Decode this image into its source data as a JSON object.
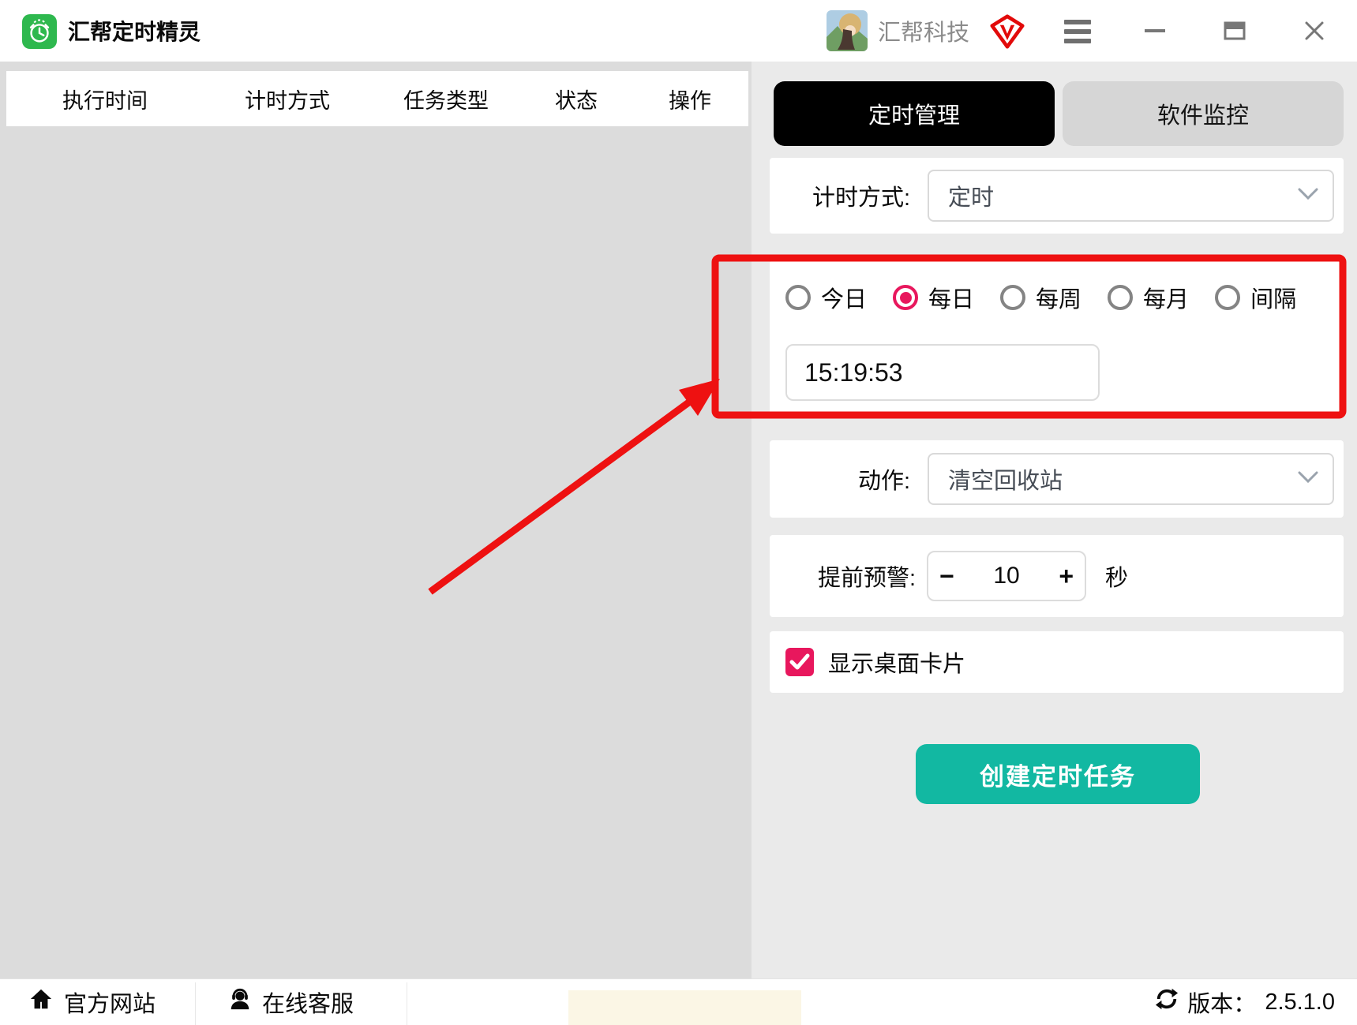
{
  "titlebar": {
    "app_title": "汇帮定时精灵",
    "brand": "汇帮科技"
  },
  "task_table": {
    "headers": [
      "执行时间",
      "计时方式",
      "任务类型",
      "状态",
      "操作"
    ]
  },
  "tabs": {
    "timer_management": "定时管理",
    "software_monitor": "软件监控"
  },
  "form": {
    "timing_mode": {
      "label": "计时方式:",
      "value": "定时"
    },
    "schedule": {
      "options": [
        {
          "label": "今日",
          "selected": false
        },
        {
          "label": "每日",
          "selected": true
        },
        {
          "label": "每周",
          "selected": false
        },
        {
          "label": "每月",
          "selected": false
        },
        {
          "label": "间隔",
          "selected": false
        }
      ],
      "time": "15:19:53"
    },
    "action": {
      "label": "动作:",
      "value": "清空回收站"
    },
    "pre_warning": {
      "label": "提前预警:",
      "minus": "−",
      "value": "10",
      "plus": "+",
      "unit": "秒"
    },
    "desktop_card": {
      "label": "显示桌面卡片",
      "checked": true
    },
    "create_button": "创建定时任务"
  },
  "footer": {
    "official_site": "官方网站",
    "online_support": "在线客服",
    "version_label": "版本：",
    "version": "2.5.1.0"
  },
  "colors": {
    "app_green": "#2eb84e",
    "accent_pink": "#e8175d",
    "button_teal": "#12b8a2",
    "annotation_red": "#ee1111",
    "active_tab_black": "#000000"
  }
}
